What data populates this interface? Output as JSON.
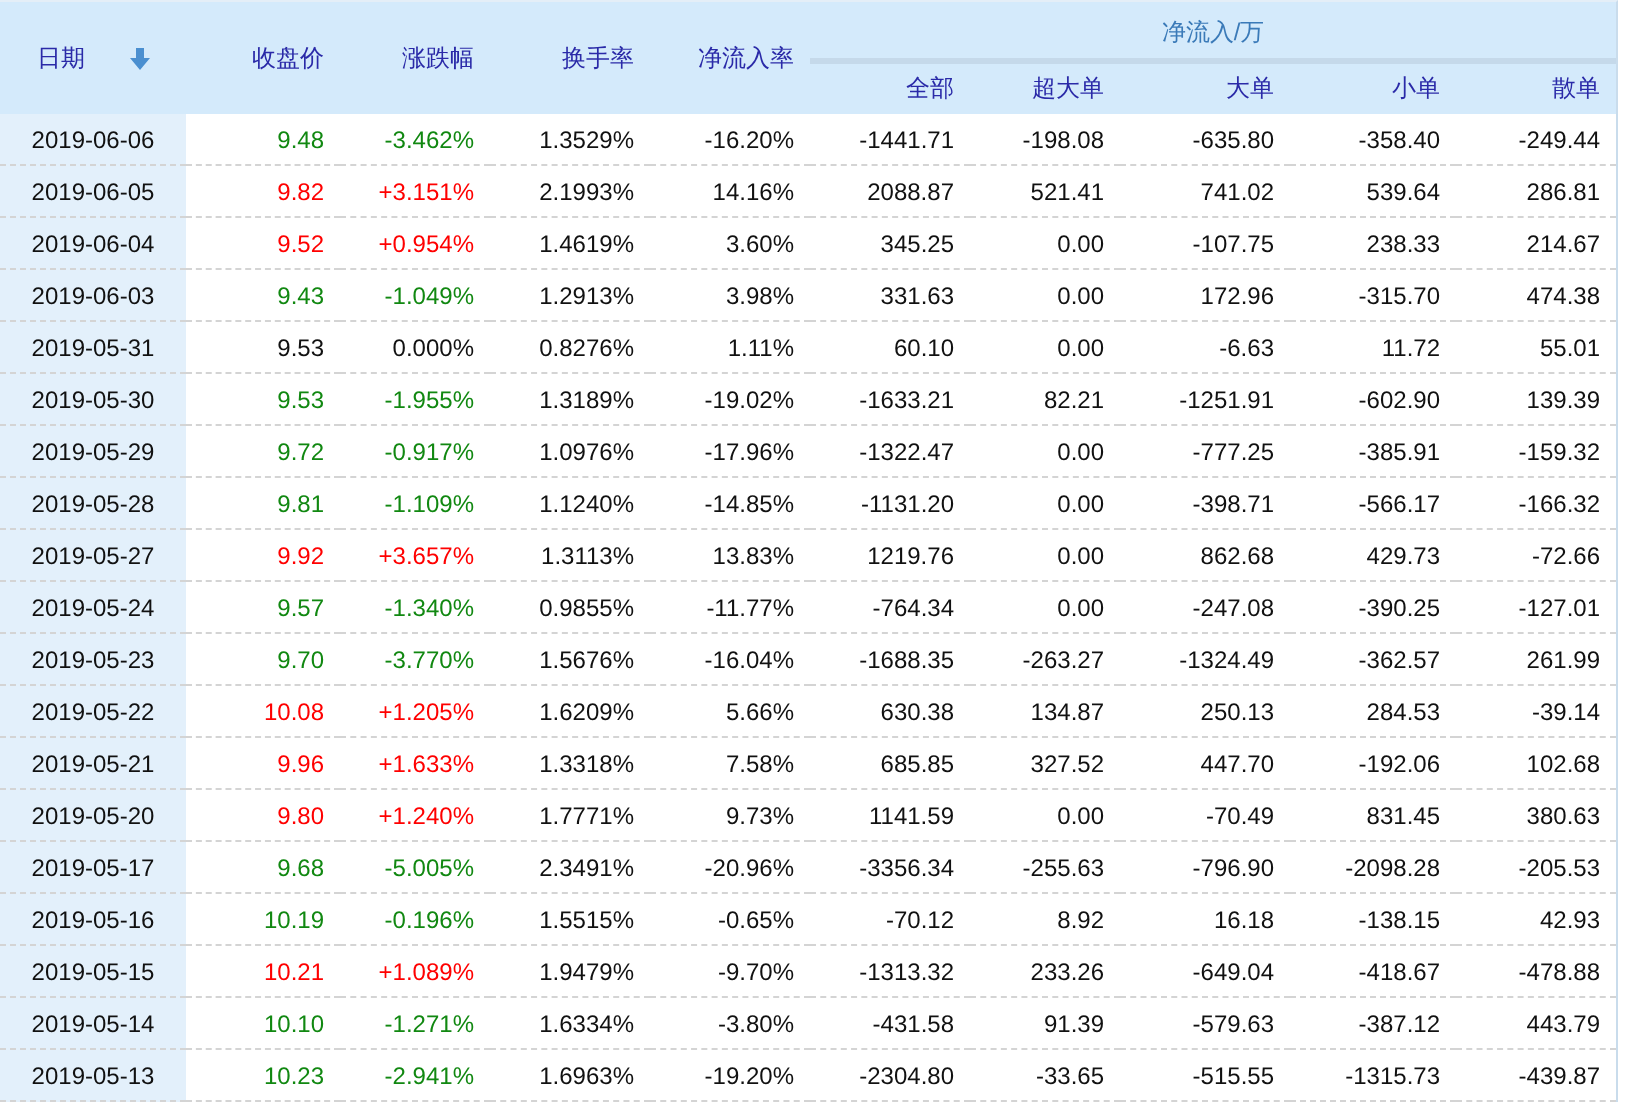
{
  "table": {
    "columns": [
      {
        "label": "日期",
        "sorted": true
      },
      {
        "label": "收盘价",
        "sorted": false
      },
      {
        "label": "涨跌幅",
        "sorted": false
      },
      {
        "label": "换手率",
        "sorted": false
      },
      {
        "label": "净流入率",
        "sorted": false
      }
    ],
    "group": {
      "label": "净流入/万",
      "columns": [
        "全部",
        "超大单",
        "大单",
        "小单",
        "散单"
      ]
    },
    "rows": [
      {
        "date": "2019-06-06",
        "close": "9.48",
        "change": "-3.462%",
        "turnover": "1.3529%",
        "inflow_rate": "-16.20%",
        "flows": [
          "-1441.71",
          "-198.08",
          "-635.80",
          "-358.40",
          "-249.44"
        ],
        "color": "#118811"
      },
      {
        "date": "2019-06-05",
        "close": "9.82",
        "change": "+3.151%",
        "turnover": "2.1993%",
        "inflow_rate": "14.16%",
        "flows": [
          "2088.87",
          "521.41",
          "741.02",
          "539.64",
          "286.81"
        ],
        "color": "#ff0000"
      },
      {
        "date": "2019-06-04",
        "close": "9.52",
        "change": "+0.954%",
        "turnover": "1.4619%",
        "inflow_rate": "3.60%",
        "flows": [
          "345.25",
          "0.00",
          "-107.75",
          "238.33",
          "214.67"
        ],
        "color": "#ff0000"
      },
      {
        "date": "2019-06-03",
        "close": "9.43",
        "change": "-1.049%",
        "turnover": "1.2913%",
        "inflow_rate": "3.98%",
        "flows": [
          "331.63",
          "0.00",
          "172.96",
          "-315.70",
          "474.38"
        ],
        "color": "#118811"
      },
      {
        "date": "2019-05-31",
        "close": "9.53",
        "change": "0.000%",
        "turnover": "0.8276%",
        "inflow_rate": "1.11%",
        "flows": [
          "60.10",
          "0.00",
          "-6.63",
          "11.72",
          "55.01"
        ],
        "color": "#111111"
      },
      {
        "date": "2019-05-30",
        "close": "9.53",
        "change": "-1.955%",
        "turnover": "1.3189%",
        "inflow_rate": "-19.02%",
        "flows": [
          "-1633.21",
          "82.21",
          "-1251.91",
          "-602.90",
          "139.39"
        ],
        "color": "#118811"
      },
      {
        "date": "2019-05-29",
        "close": "9.72",
        "change": "-0.917%",
        "turnover": "1.0976%",
        "inflow_rate": "-17.96%",
        "flows": [
          "-1322.47",
          "0.00",
          "-777.25",
          "-385.91",
          "-159.32"
        ],
        "color": "#118811"
      },
      {
        "date": "2019-05-28",
        "close": "9.81",
        "change": "-1.109%",
        "turnover": "1.1240%",
        "inflow_rate": "-14.85%",
        "flows": [
          "-1131.20",
          "0.00",
          "-398.71",
          "-566.17",
          "-166.32"
        ],
        "color": "#118811"
      },
      {
        "date": "2019-05-27",
        "close": "9.92",
        "change": "+3.657%",
        "turnover": "1.3113%",
        "inflow_rate": "13.83%",
        "flows": [
          "1219.76",
          "0.00",
          "862.68",
          "429.73",
          "-72.66"
        ],
        "color": "#ff0000"
      },
      {
        "date": "2019-05-24",
        "close": "9.57",
        "change": "-1.340%",
        "turnover": "0.9855%",
        "inflow_rate": "-11.77%",
        "flows": [
          "-764.34",
          "0.00",
          "-247.08",
          "-390.25",
          "-127.01"
        ],
        "color": "#118811"
      },
      {
        "date": "2019-05-23",
        "close": "9.70",
        "change": "-3.770%",
        "turnover": "1.5676%",
        "inflow_rate": "-16.04%",
        "flows": [
          "-1688.35",
          "-263.27",
          "-1324.49",
          "-362.57",
          "261.99"
        ],
        "color": "#118811"
      },
      {
        "date": "2019-05-22",
        "close": "10.08",
        "change": "+1.205%",
        "turnover": "1.6209%",
        "inflow_rate": "5.66%",
        "flows": [
          "630.38",
          "134.87",
          "250.13",
          "284.53",
          "-39.14"
        ],
        "color": "#ff0000"
      },
      {
        "date": "2019-05-21",
        "close": "9.96",
        "change": "+1.633%",
        "turnover": "1.3318%",
        "inflow_rate": "7.58%",
        "flows": [
          "685.85",
          "327.52",
          "447.70",
          "-192.06",
          "102.68"
        ],
        "color": "#ff0000"
      },
      {
        "date": "2019-05-20",
        "close": "9.80",
        "change": "+1.240%",
        "turnover": "1.7771%",
        "inflow_rate": "9.73%",
        "flows": [
          "1141.59",
          "0.00",
          "-70.49",
          "831.45",
          "380.63"
        ],
        "color": "#ff0000"
      },
      {
        "date": "2019-05-17",
        "close": "9.68",
        "change": "-5.005%",
        "turnover": "2.3491%",
        "inflow_rate": "-20.96%",
        "flows": [
          "-3356.34",
          "-255.63",
          "-796.90",
          "-2098.28",
          "-205.53"
        ],
        "color": "#118811"
      },
      {
        "date": "2019-05-16",
        "close": "10.19",
        "change": "-0.196%",
        "turnover": "1.5515%",
        "inflow_rate": "-0.65%",
        "flows": [
          "-70.12",
          "8.92",
          "16.18",
          "-138.15",
          "42.93"
        ],
        "color": "#118811"
      },
      {
        "date": "2019-05-15",
        "close": "10.21",
        "change": "+1.089%",
        "turnover": "1.9479%",
        "inflow_rate": "-9.70%",
        "flows": [
          "-1313.32",
          "233.26",
          "-649.04",
          "-418.67",
          "-478.88"
        ],
        "color": "#ff0000"
      },
      {
        "date": "2019-05-14",
        "close": "10.10",
        "change": "-1.271%",
        "turnover": "1.6334%",
        "inflow_rate": "-3.80%",
        "flows": [
          "-431.58",
          "91.39",
          "-579.63",
          "-387.12",
          "443.79"
        ],
        "color": "#118811"
      },
      {
        "date": "2019-05-13",
        "close": "10.23",
        "change": "-2.941%",
        "turnover": "1.6963%",
        "inflow_rate": "-19.20%",
        "flows": [
          "-2304.80",
          "-33.65",
          "-515.55",
          "-1315.73",
          "-439.87"
        ],
        "color": "#118811"
      }
    ]
  }
}
